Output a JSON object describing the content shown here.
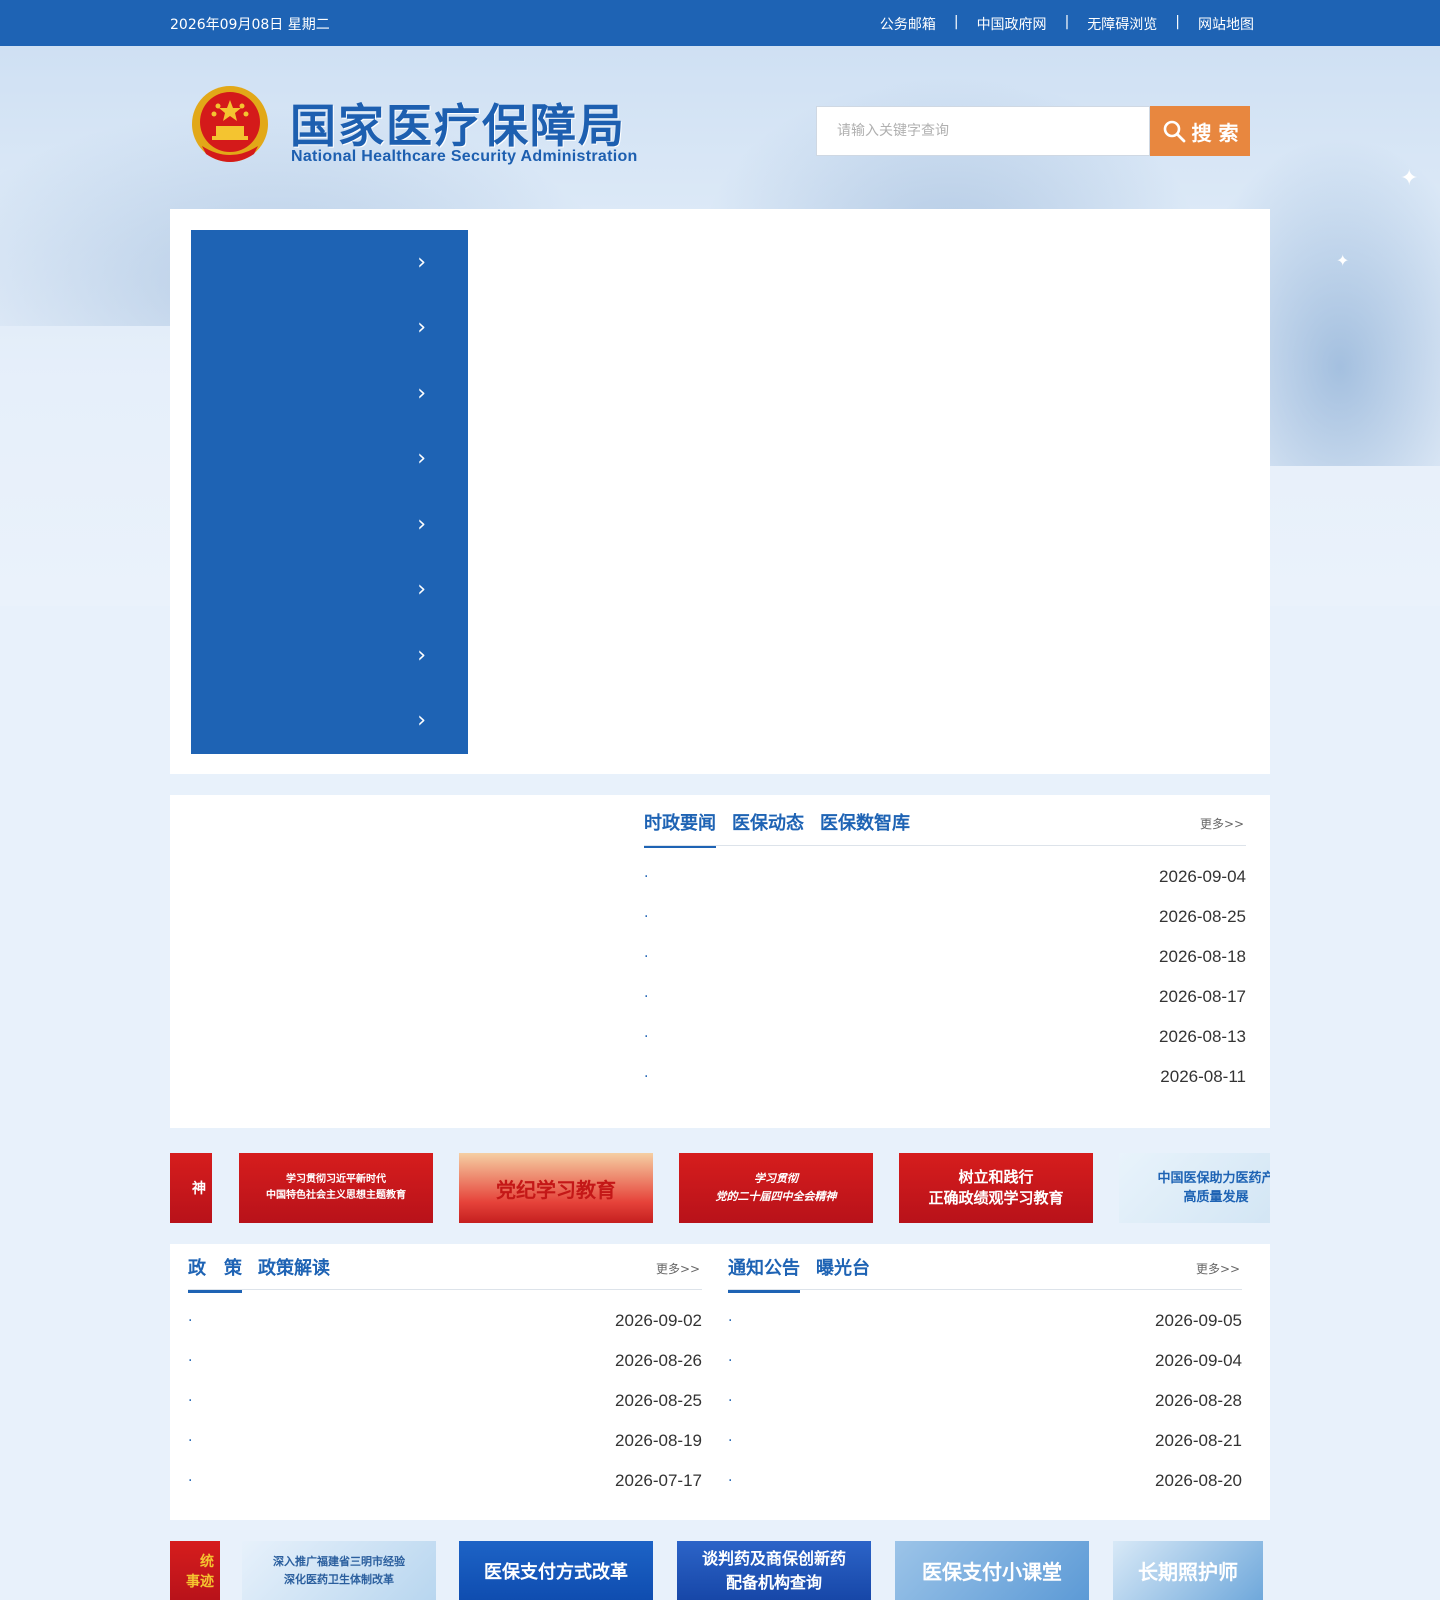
{
  "topbar": {
    "date": "2026年09月08日 星期二",
    "links": [
      "公务邮箱",
      "中国政府网",
      "无障碍浏览",
      "网站地图"
    ],
    "separator": "|"
  },
  "header": {
    "title_cn": "国家医疗保障局",
    "title_en": "National Healthcare Security Administration",
    "search_placeholder": "请输入关键字查询",
    "search_button": "搜 索"
  },
  "side_menu": {
    "items": [
      "",
      "",
      "",
      "",
      "",
      "",
      "",
      ""
    ],
    "chevron": "›"
  },
  "news": {
    "tabs": [
      "时政要闻",
      "医保动态",
      "医保数智库"
    ],
    "more": "更多>>",
    "items": [
      {
        "title": "",
        "date": "2026-09-04"
      },
      {
        "title": "",
        "date": "2026-08-25"
      },
      {
        "title": "",
        "date": "2026-08-18"
      },
      {
        "title": "",
        "date": "2026-08-17"
      },
      {
        "title": "",
        "date": "2026-08-13"
      },
      {
        "title": "",
        "date": "2026-08-11"
      }
    ]
  },
  "banners_row1": [
    {
      "line1": "神",
      "line2": ""
    },
    {
      "line1": "学习贯彻习近平新时代",
      "line2": "中国特色社会主义思想主题教育"
    },
    {
      "line1": "党纪学习教育",
      "line2": ""
    },
    {
      "line1": "学习贯彻",
      "line2": "党的二十届四中全会精神"
    },
    {
      "line1": "树立和践行",
      "line2": "正确政绩观学习教育"
    },
    {
      "line1": "中国医保助力医药产",
      "line2": "高质量发展"
    }
  ],
  "policy": {
    "tabs": [
      "政　策",
      "政策解读"
    ],
    "more": "更多>>",
    "items": [
      {
        "title": "",
        "date": "2026-09-02"
      },
      {
        "title": "",
        "date": "2026-08-26"
      },
      {
        "title": "",
        "date": "2026-08-25"
      },
      {
        "title": "",
        "date": "2026-08-19"
      },
      {
        "title": "",
        "date": "2026-07-17"
      }
    ]
  },
  "notice": {
    "tabs": [
      "通知公告",
      "曝光台"
    ],
    "more": "更多>>",
    "items": [
      {
        "title": "",
        "date": "2026-09-05"
      },
      {
        "title": "",
        "date": "2026-09-04"
      },
      {
        "title": "",
        "date": "2026-08-28"
      },
      {
        "title": "",
        "date": "2026-08-21"
      },
      {
        "title": "",
        "date": "2026-08-20"
      }
    ]
  },
  "banners_row2": [
    {
      "line1": "统",
      "line2": "事迹"
    },
    {
      "line1": "深入推广福建省三明市经验",
      "line2": "深化医药卫生体制改革"
    },
    {
      "line1": "医保支付方式改革",
      "line2": ""
    },
    {
      "line1": "谈判药及商保创新药",
      "line2": "配备机构查询"
    },
    {
      "line1": "医保支付小课堂",
      "line2": ""
    },
    {
      "line1": "长期照护师",
      "line2": ""
    }
  ],
  "colors": {
    "primary": "#1e63b4",
    "search_button": "#e8873f",
    "banner_red": "#c8161d"
  }
}
